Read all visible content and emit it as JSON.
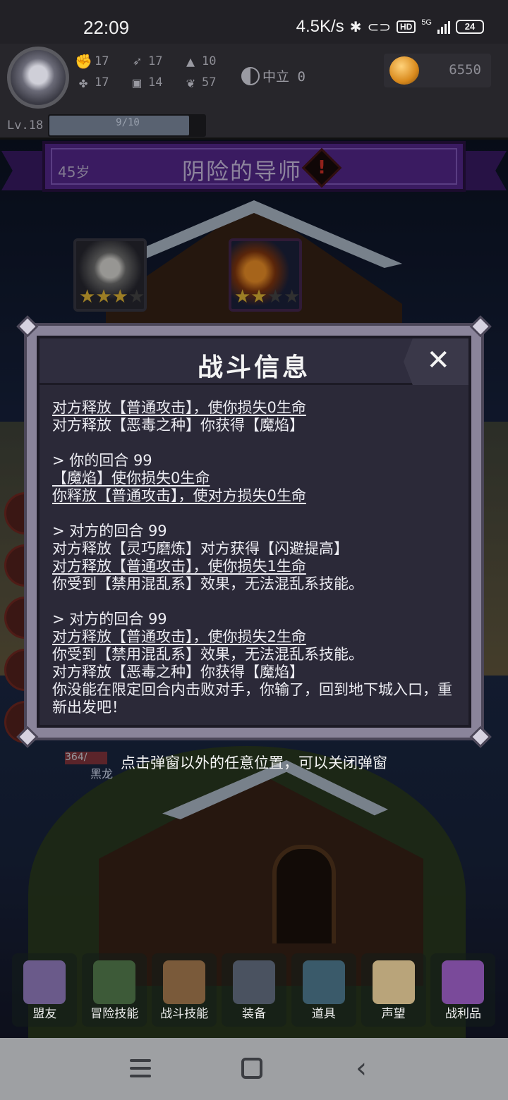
{
  "status_bar": {
    "time": "22:09",
    "net_speed": "4.5K/s",
    "hd_badge": "HD",
    "network_type": "5G",
    "battery": "24"
  },
  "player": {
    "stats": [
      {
        "icon": "fist-icon",
        "glyph": "✊",
        "value": "17"
      },
      {
        "icon": "wing-icon",
        "glyph": "➶",
        "value": "17"
      },
      {
        "icon": "wizard-hat-icon",
        "glyph": "▲",
        "value": "10"
      },
      {
        "icon": "clover-icon",
        "glyph": "✤",
        "value": "17"
      },
      {
        "icon": "chest-armor-icon",
        "glyph": "▣",
        "value": "14"
      },
      {
        "icon": "lotus-icon",
        "glyph": "❦",
        "value": "57"
      }
    ],
    "alignment": "中立 0",
    "gold": "6550",
    "level": "Lv.18",
    "xp_text": "9/10",
    "xp_fraction": 0.9
  },
  "encounter": {
    "age": "45岁",
    "title": "阴险的导师",
    "cards": [
      {
        "name": "white-robed-mage",
        "stars_on": 3,
        "stars_total": 4
      },
      {
        "name": "fire-ice-sorcerer",
        "stars_on": 2,
        "stars_total": 4
      }
    ]
  },
  "modal": {
    "title": "战斗信息",
    "close_label": "✕",
    "log": [
      {
        "text": "对方释放【普通攻击】，使你损失0生命",
        "underline": true
      },
      {
        "text": "对方释放【恶毒之种】你获得【魔焰】",
        "underline": false
      },
      {
        "text": "",
        "underline": false
      },
      {
        "text": "> 你的回合 99",
        "underline": false
      },
      {
        "text": "【魔焰】使你损失0生命",
        "underline": true
      },
      {
        "text": "你释放【普通攻击】，使对方损失0生命",
        "underline": true
      },
      {
        "text": "",
        "underline": false
      },
      {
        "text": "> 对方的回合 99",
        "underline": false
      },
      {
        "text": "对方释放【灵巧磨炼】对方获得【闪避提高】",
        "underline": false
      },
      {
        "text": "对方释放【普通攻击】，使你损失1生命",
        "underline": true
      },
      {
        "text": "你受到【禁用混乱系】效果，无法混乱系技能。",
        "underline": false
      },
      {
        "text": "",
        "underline": false
      },
      {
        "text": "> 对方的回合 99",
        "underline": false
      },
      {
        "text": "对方释放【普通攻击】，使你损失2生命",
        "underline": true
      },
      {
        "text": "你受到【禁用混乱系】效果，无法混乱系技能。",
        "underline": false
      },
      {
        "text": "对方释放【恶毒之种】你获得【魔焰】",
        "underline": false
      },
      {
        "text": "你没能在限定回合内击败对手，你输了，回到地下城入口，重新出发吧！",
        "underline": false
      }
    ]
  },
  "hint": "点击弹窗以外的任意位置，可以关闭弹窗",
  "behind_labels": {
    "hp": "364/",
    "name": "黑龙"
  },
  "menu": [
    {
      "label": "盟友",
      "icon": "gloves-icon",
      "color": "#6a5a8a"
    },
    {
      "label": "冒险技能",
      "icon": "book-icon",
      "color": "#3d5a38"
    },
    {
      "label": "战斗技能",
      "icon": "bag-icon",
      "color": "#7a5a3a"
    },
    {
      "label": "装备",
      "icon": "crossed-swords-icon",
      "color": "#4a5260"
    },
    {
      "label": "道具",
      "icon": "backpack-icon",
      "color": "#3a5a6a"
    },
    {
      "label": "声望",
      "icon": "scroll-icon",
      "color": "#b9a47a"
    },
    {
      "label": "战利品",
      "icon": "treasure-chest-icon",
      "color": "#7a4a9a"
    }
  ]
}
